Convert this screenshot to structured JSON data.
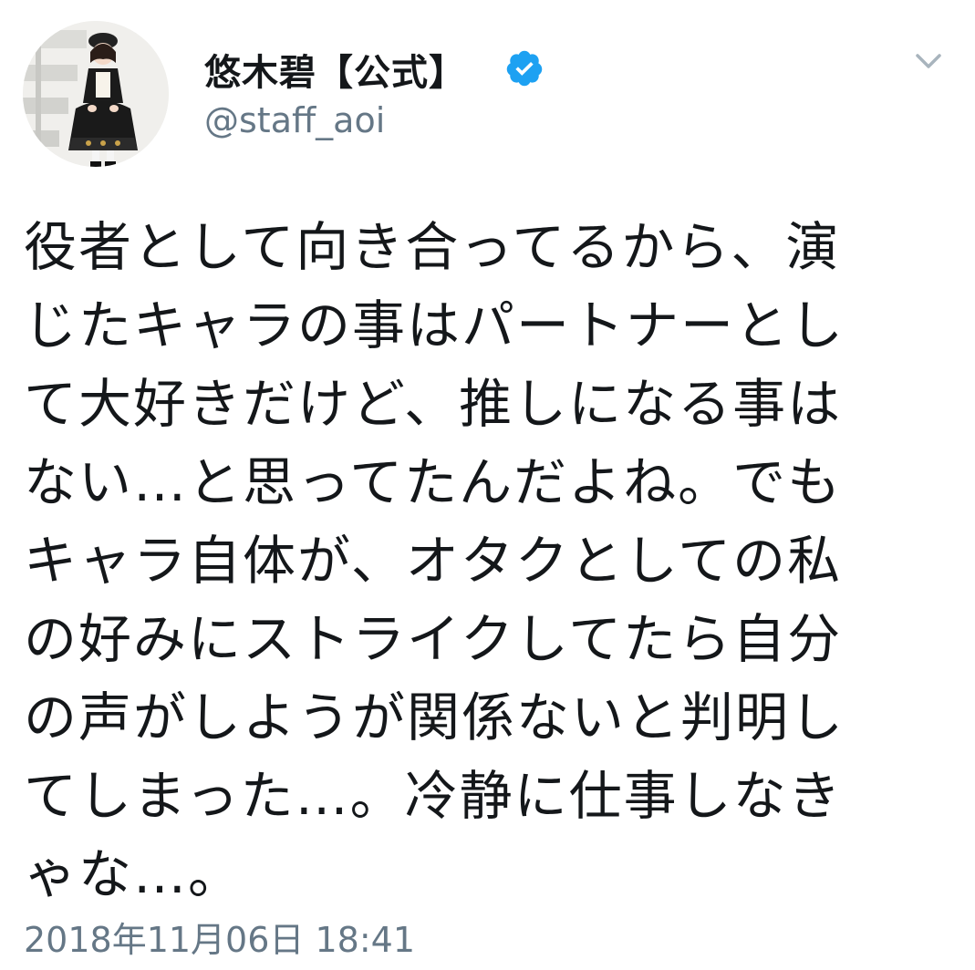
{
  "author": {
    "display_name": "悠木碧【公式】",
    "handle": "@staff_aoi",
    "verified": true,
    "avatar_icon": "profile-photo"
  },
  "tweet": {
    "lines": [
      "役者として向き合ってるから、演",
      "じたキャラの事はパートナーとし",
      "て大好きだけど、推しになる事は",
      "ない…と思ってたんだよね。でも",
      "キャラ自体が、オタクとしての私",
      "の好みにストライクしてたら自分",
      "の声がしようが関係ないと判明し",
      "てしまった…。冷静に仕事しなき",
      "ゃな…。"
    ],
    "timestamp": "2018年11月06日 18:41"
  },
  "icons": {
    "verified": "verified-badge-icon",
    "menu": "chevron-down-icon"
  },
  "colors": {
    "text": "#14171a",
    "secondary_text": "#657786",
    "verified_blue": "#1da1f2",
    "background": "#ffffff"
  }
}
